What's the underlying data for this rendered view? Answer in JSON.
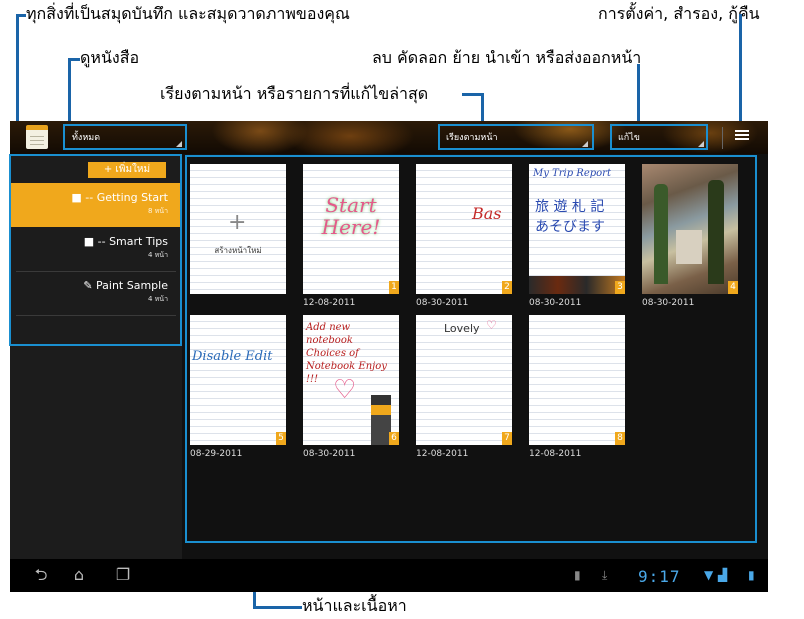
{
  "callouts": {
    "all_notebooks": "ทุกสิ่งที่เป็นสมุดบันทึก และสมุดวาดภาพของคุณ",
    "view_books": "ดูหนังสือ",
    "settings_backup": "การตั้งค่า, สำรอง, กู้คืน",
    "page_ops": "ลบ คัดลอก ย้าย นำเข้า หรือส่งออกหน้า",
    "sort_pages": "เรียงตามหน้า หรือรายการที่แก้ไขล่าสุด",
    "pages_content": "หน้าและเนื้อหา"
  },
  "topbar": {
    "filter_value": "ทั้งหมด",
    "sort_value": "เรียงตามหน้า",
    "edit_value": "แก้ไข"
  },
  "sidebar": {
    "add_new": "+  เพิ่มใหม่",
    "books": [
      {
        "title": "■ -- Getting Start",
        "count": "8 หน้า"
      },
      {
        "title": "■ -- Smart Tips",
        "count": "4 หน้า"
      },
      {
        "title": "✎ Paint Sample",
        "count": "4 หน้า"
      }
    ]
  },
  "grid": {
    "new_page_label": "สร้างหน้าใหม่",
    "pages": [
      {
        "num": "1",
        "date": "12-08-2011",
        "content": "Start Here!"
      },
      {
        "num": "2",
        "date": "08-30-2011",
        "content": "Bas"
      },
      {
        "num": "3",
        "date": "08-30-2011",
        "content": "My Trip Report"
      },
      {
        "num": "4",
        "date": "08-30-2011",
        "content": ""
      },
      {
        "num": "5",
        "date": "08-29-2011",
        "content": "Disable Edit"
      },
      {
        "num": "6",
        "date": "08-30-2011",
        "content": "Add new notebook Choices of Notebook Enjoy !!!"
      },
      {
        "num": "7",
        "date": "12-08-2011",
        "content": "Lovely"
      },
      {
        "num": "8",
        "date": "12-08-2011",
        "content": ""
      }
    ]
  },
  "statusbar": {
    "clock": "9:17"
  },
  "colors": {
    "accent": "#f0a81c",
    "callout_line": "#1a64a8",
    "highlight": "#1a8fd0"
  }
}
